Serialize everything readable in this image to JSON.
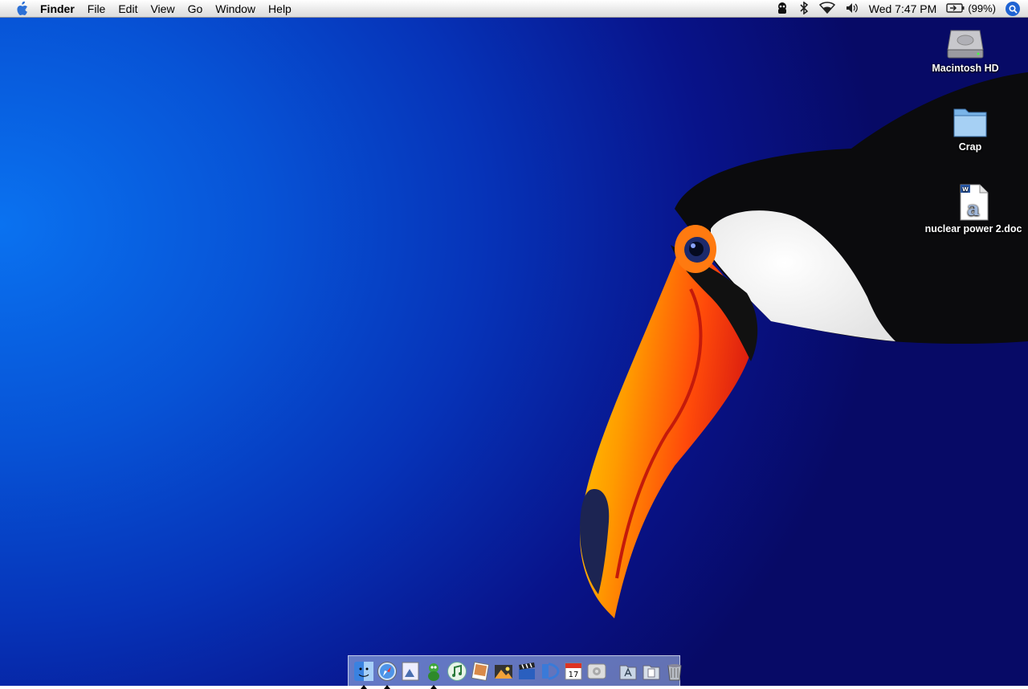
{
  "menubar": {
    "apple_icon": "apple-icon",
    "app_name": "Finder",
    "menus": [
      "File",
      "Edit",
      "View",
      "Go",
      "Window",
      "Help"
    ],
    "status": {
      "clock": "Wed 7:47 PM",
      "battery": "(99%)",
      "icons": [
        "adium-icon",
        "bluetooth-icon",
        "wifi-icon",
        "volume-icon",
        "battery-icon",
        "spotlight-icon"
      ]
    }
  },
  "desktop": {
    "icons": [
      {
        "label": "Macintosh HD",
        "icon": "hard-drive-icon"
      },
      {
        "label": "Crap",
        "icon": "folder-icon"
      },
      {
        "label": "nuclear power 2.doc",
        "icon": "word-document-icon"
      }
    ]
  },
  "dock": {
    "apps": [
      {
        "icon": "finder-icon",
        "running": true
      },
      {
        "icon": "safari-icon",
        "running": true
      },
      {
        "icon": "preview-icon",
        "running": false
      },
      {
        "icon": "adium-icon",
        "running": true
      },
      {
        "icon": "itunes-icon",
        "running": false
      },
      {
        "icon": "iphoto-icon",
        "running": false
      },
      {
        "icon": "imovie-icon",
        "running": false
      },
      {
        "icon": "clapboard-icon",
        "running": false
      },
      {
        "icon": "word-icon",
        "running": false
      },
      {
        "icon": "ical-icon",
        "running": false,
        "badge": "17"
      },
      {
        "icon": "system-preferences-icon",
        "running": false
      }
    ],
    "others": [
      {
        "icon": "applications-folder-icon"
      },
      {
        "icon": "documents-folder-icon"
      },
      {
        "icon": "trash-icon"
      }
    ]
  },
  "colors": {
    "wallpaper_light": "#0a72f0",
    "wallpaper_dark": "#070a66",
    "beak_orange": "#ff6a00",
    "beak_red": "#e8230f"
  }
}
